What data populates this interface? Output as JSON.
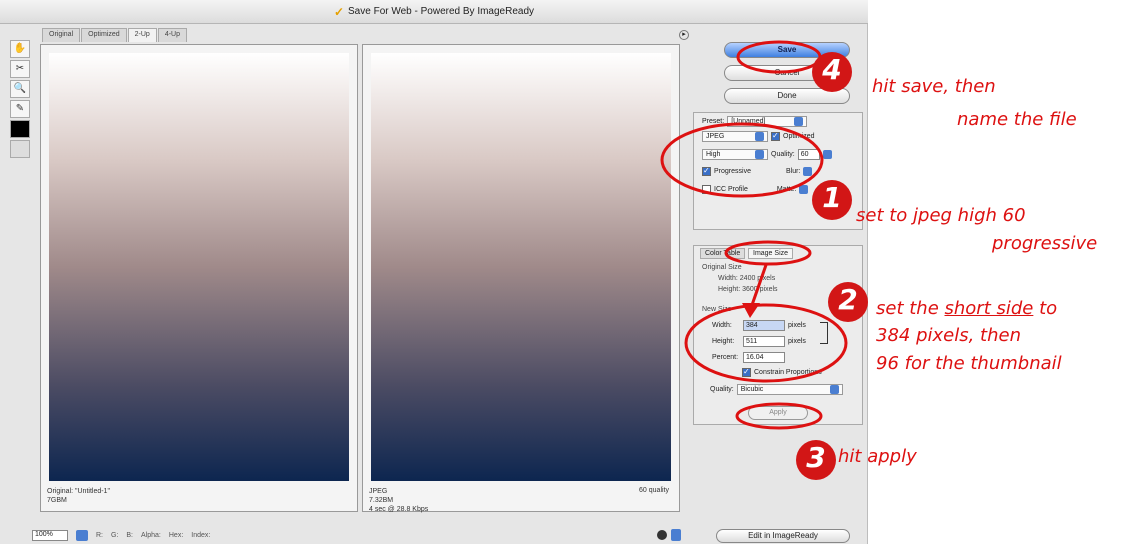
{
  "window": {
    "title": "Save For Web - Powered By ImageReady"
  },
  "tabs": [
    "Original",
    "Optimized",
    "2-Up",
    "4-Up"
  ],
  "panes": {
    "left_info": [
      "Original: \"Untitled-1\"",
      "7GBM"
    ],
    "right_info": [
      "JPEG",
      "7.32BM",
      "4 sec @ 28.8 Kbps"
    ],
    "right_quality": "60 quality"
  },
  "statusbar": {
    "zoom": "100%",
    "r": "R:",
    "g": "G:",
    "b": "B:",
    "alpha": "Alpha:",
    "hex": "Hex:",
    "index": "Index:"
  },
  "buttons": {
    "save": "Save",
    "cancel": "Cancel",
    "done": "Done",
    "apply": "Apply",
    "edit_in_imageready": "Edit in ImageReady"
  },
  "settings": {
    "preset_label": "Preset:",
    "preset_value": "[Unnamed]",
    "format": "JPEG",
    "quality_level": "High",
    "quality_label": "Quality:",
    "quality_value": "60",
    "progressive_label": "Progressive",
    "blur_label": "Blur:",
    "matte_label": "Matte:",
    "optimized_label": "Optimized",
    "icc_label": "ICC Profile"
  },
  "image_size": {
    "tab_color_table": "Color Table",
    "tab_image_size": "Image Size",
    "original_label": "Original Size",
    "orig_width": "Width: 2400 pixels",
    "orig_height": "Height: 3600 pixels",
    "new_label": "New Size",
    "width_label": "Width:",
    "width_value": "384",
    "height_label": "Height:",
    "height_value": "511",
    "percent_label": "Percent:",
    "percent_value": "16.04",
    "unit_pixels": "pixels",
    "constrain_label": "Constrain Proportions",
    "quality_label": "Quality:",
    "quality_value": "Bicubic"
  },
  "annotations": {
    "step1_num": "1",
    "step1_line1": "set to jpeg high  60",
    "step1_line2": "progressive",
    "step2_num": "2",
    "step2_pre": "set the ",
    "step2_underline": "short side",
    "step2_post": " to",
    "step2_line2": "384 pixels, then",
    "step2_line3": "96 for the thumbnail",
    "step3_num": "3",
    "step3_text": "hit apply",
    "step4_num": "4",
    "step4_line1": "hit save, then",
    "step4_line2": "name the file",
    "color": "#dd1111"
  }
}
